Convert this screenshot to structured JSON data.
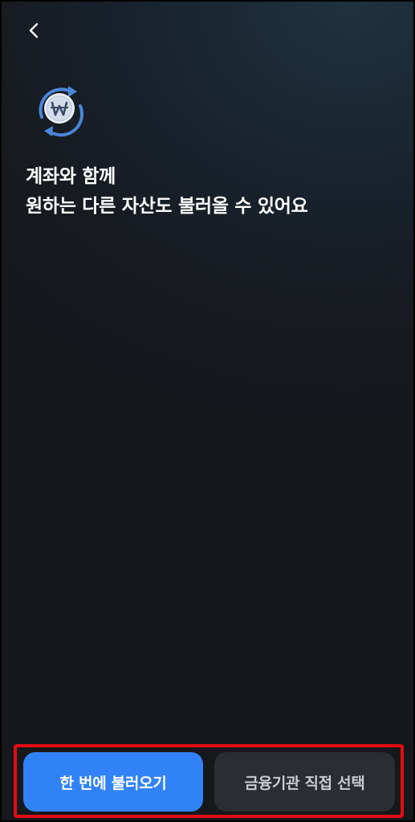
{
  "header": {
    "back_icon": "chevron-left-icon"
  },
  "hero": {
    "icon": "won-coin-refresh-icon",
    "accent_color": "#4a86d9",
    "headline_line1": "계좌와 함께",
    "headline_line2": "원하는 다른 자산도 불러올 수 있어요"
  },
  "actions": {
    "primary_label": "한 번에 불러오기",
    "secondary_label": "금융기관 직접 선택",
    "primary_color": "#3182f6",
    "secondary_color": "#2c2d33",
    "highlight_color": "#e10d12"
  }
}
